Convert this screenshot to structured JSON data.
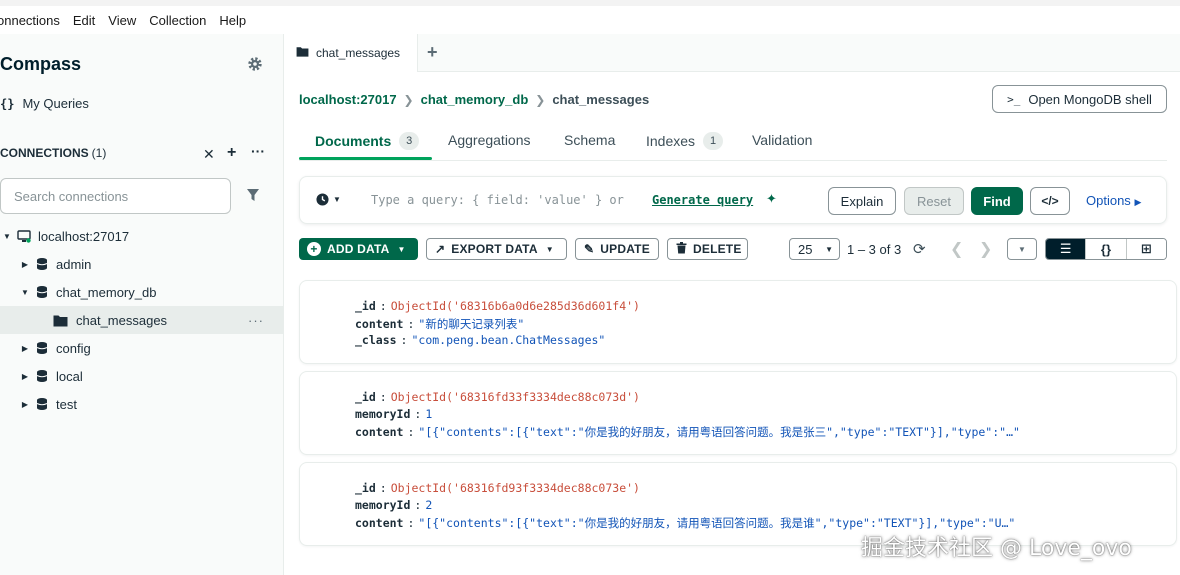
{
  "menubar": {
    "items": [
      "onnections",
      "Edit",
      "View",
      "Collection",
      "Help"
    ]
  },
  "sidebar": {
    "title": "Compass",
    "my_queries_icon": "{}",
    "my_queries": "My Queries",
    "connections_label": "CONNECTIONS",
    "connections_count": "(1)",
    "search_placeholder": "Search connections",
    "tree": {
      "host": "localhost:27017",
      "databases": [
        "admin",
        "chat_memory_db",
        "config",
        "local",
        "test"
      ],
      "collection": "chat_messages",
      "more": "…"
    }
  },
  "tabs": {
    "active_tab": "chat_messages",
    "add": "+"
  },
  "breadcrumb": {
    "host": "localhost:27017",
    "database": "chat_memory_db",
    "collection": "chat_messages"
  },
  "shell_button": {
    "prompt": ">_",
    "label": "Open MongoDB shell"
  },
  "subtabs": [
    {
      "label": "Documents",
      "badge": "3"
    },
    {
      "label": "Aggregations"
    },
    {
      "label": "Schema"
    },
    {
      "label": "Indexes",
      "badge": "1"
    },
    {
      "label": "Validation"
    }
  ],
  "query_bar": {
    "placeholder": "Type a query: { field: 'value' } or",
    "generate_link": "Generate query",
    "explain": "Explain",
    "reset": "Reset",
    "find": "Find",
    "code": "</>",
    "options": "Options"
  },
  "actions": {
    "add_data": "ADD DATA",
    "export_data": "EXPORT DATA",
    "update": "UPDATE",
    "delete": "DELETE"
  },
  "pagination": {
    "page_size": "25",
    "range": "1 – 3 of 3"
  },
  "documents": [
    {
      "id_key": "_id",
      "id_value": "ObjectId('68316b6a0d6e285d36d601f4')",
      "f2_key": "content",
      "f2_value": "\"新的聊天记录列表\"",
      "f3_key": "_class",
      "f3_value": "\"com.peng.bean.ChatMessages\""
    },
    {
      "id_key": "_id",
      "id_value": "ObjectId('68316fd33f3334dec88c073d')",
      "f2_key": "memoryId",
      "f2_value": "1",
      "f3_key": "content",
      "f3_value": "\"[{\"contents\":[{\"text\":\"你是我的好朋友，请用粤语回答问题。我是张三\",\"type\":\"TEXT\"}],\"type\":\"…\""
    },
    {
      "id_key": "_id",
      "id_value": "ObjectId('68316fd93f3334dec88c073e')",
      "f2_key": "memoryId",
      "f2_value": "2",
      "f3_key": "content",
      "f3_value": "\"[{\"contents\":[{\"text\":\"你是我的好朋友，请用粤语回答问题。我是谁\",\"type\":\"TEXT\"}],\"type\":\"U…\""
    }
  ],
  "watermark": "掘金技术社区 @ Love_ovo",
  "colors": {
    "accent_green": "#00684a",
    "brand_green": "#00a35c",
    "objectid_red": "#c84e3b",
    "string_blue": "#1254b7"
  },
  "icons": {
    "gear": "gear-icon",
    "filter": "filter-icon",
    "host": "server-icon",
    "database": "database-icon",
    "collection": "folder-icon",
    "history": "clock-icon",
    "refresh": "refresh-icon"
  }
}
